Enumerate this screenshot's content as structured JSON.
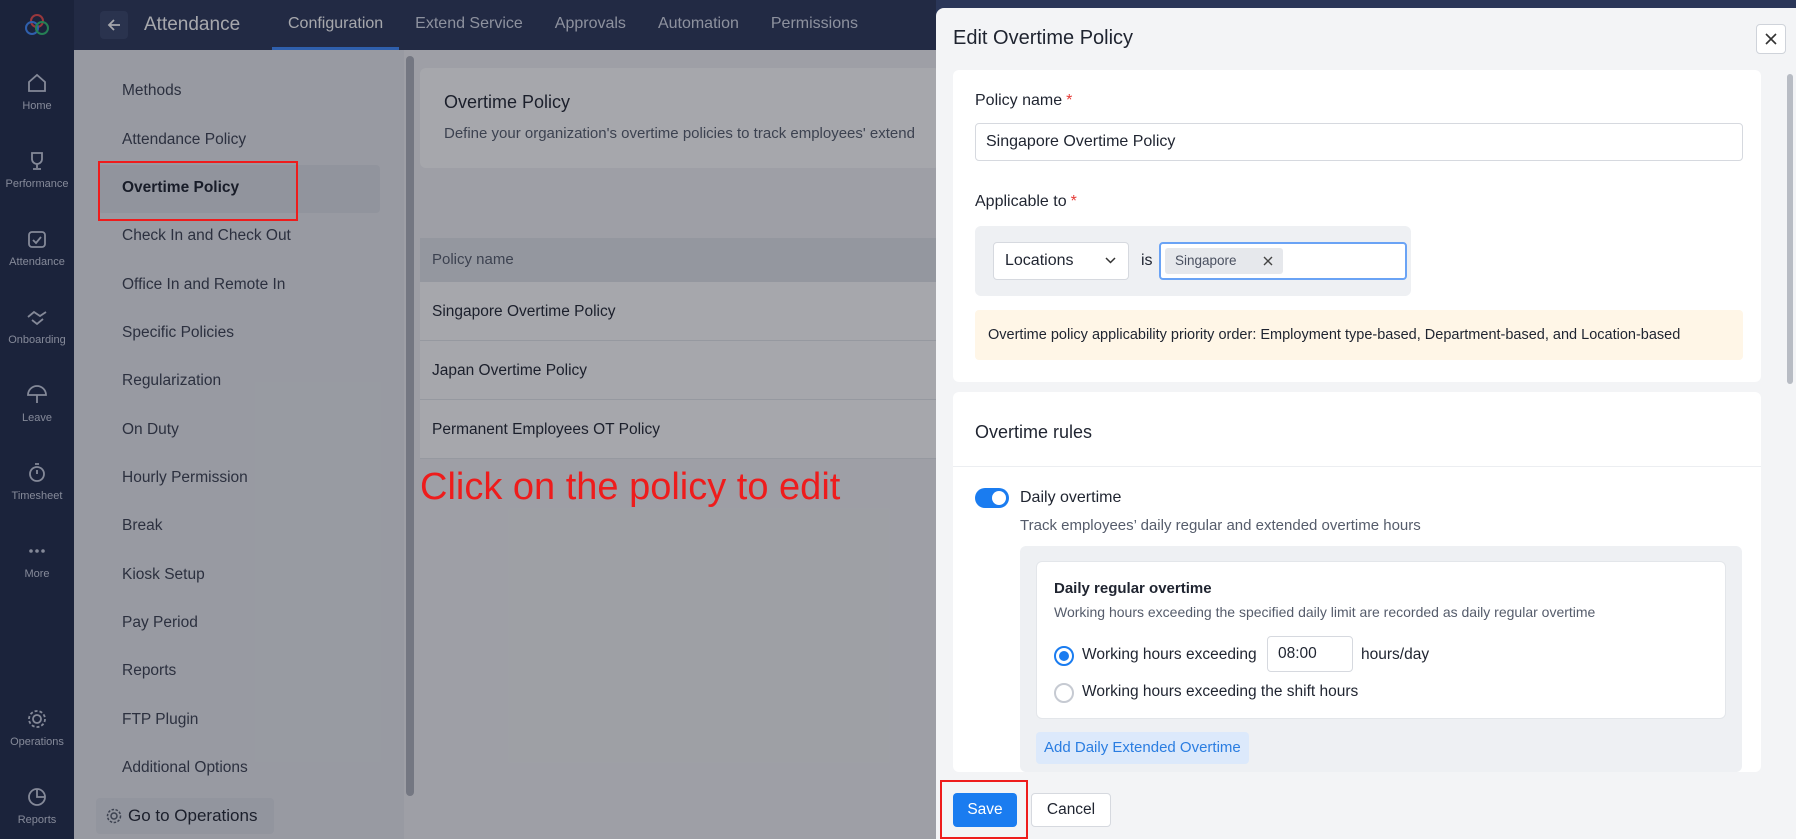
{
  "rail": {
    "items": [
      {
        "label": "Home",
        "icon": "home-icon"
      },
      {
        "label": "Performance",
        "icon": "trophy-icon"
      },
      {
        "label": "Attendance",
        "icon": "calendar-check-icon"
      },
      {
        "label": "Onboarding",
        "icon": "handshake-icon"
      },
      {
        "label": "Leave",
        "icon": "umbrella-icon"
      },
      {
        "label": "Timesheet",
        "icon": "timer-icon"
      },
      {
        "label": "More",
        "icon": "ellipsis-icon"
      },
      {
        "label": "Operations",
        "icon": "gear-icon"
      },
      {
        "label": "Reports",
        "icon": "pie-chart-icon"
      }
    ]
  },
  "topbar": {
    "title": "Attendance",
    "tabs": [
      {
        "label": "Configuration",
        "active": true
      },
      {
        "label": "Extend Service"
      },
      {
        "label": "Approvals"
      },
      {
        "label": "Automation"
      },
      {
        "label": "Permissions"
      }
    ]
  },
  "sidemenu": {
    "items": [
      "Methods",
      "Attendance Policy",
      "Overtime Policy",
      "Check In and Check Out",
      "Office In and Remote In",
      "Specific Policies",
      "Regularization",
      "On Duty",
      "Hourly Permission",
      "Break",
      "Kiosk Setup",
      "Pay Period",
      "Reports",
      "FTP Plugin",
      "Additional Options"
    ],
    "active_index": 2,
    "go_to_operations": "Go to Operations"
  },
  "main": {
    "card_title": "Overtime Policy",
    "card_desc": "Define your organization's overtime policies to track employees' extend",
    "table_header": "Policy name",
    "rows": [
      "Singapore Overtime Policy",
      "Japan Overtime Policy",
      "Permanent Employees OT Policy"
    ],
    "annotation": "Click on the policy to edit"
  },
  "drawer": {
    "title": "Edit Overtime Policy",
    "policy_name_label": "Policy name",
    "required_mark": "*",
    "policy_name_value": "Singapore Overtime Policy",
    "applicable_label": "Applicable to",
    "criteria_select": "Locations",
    "is_label": "is",
    "chip": "Singapore",
    "notice": "Overtime policy applicability priority order: Employment type-based, Department-based, and Location-based",
    "rules_title": "Overtime rules",
    "daily_title": "Daily overtime",
    "daily_desc": "Track employees’ daily regular and extended overtime hours",
    "sub_title": "Daily regular overtime",
    "sub_desc": "Working hours exceeding the specified daily limit are recorded as daily regular overtime",
    "radio1_label": "Working hours exceeding",
    "radio1_value": "08:00",
    "radio1_unit": "hours/day",
    "radio2_label": "Working hours exceeding the shift hours",
    "add_extended": "Add Daily Extended Overtime",
    "save": "Save",
    "cancel": "Cancel"
  },
  "colors": {
    "rail": "#202a4a",
    "topbar": "#2a3658",
    "accent": "#1a7cf0",
    "highlight": "#ee1c1c"
  }
}
